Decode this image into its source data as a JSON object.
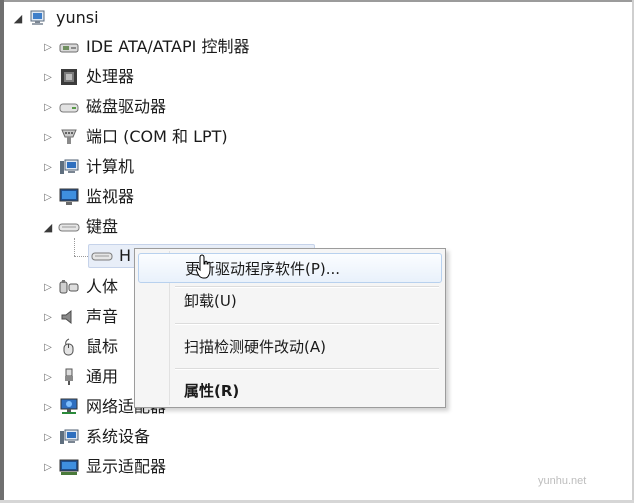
{
  "tree": {
    "root": {
      "label": "yunsi",
      "icon": "computer-icon"
    },
    "items": [
      {
        "label": "IDE ATA/ATAPI 控制器",
        "icon": "ide-controller-icon"
      },
      {
        "label": "处理器",
        "icon": "processor-icon"
      },
      {
        "label": "磁盘驱动器",
        "icon": "disk-drive-icon"
      },
      {
        "label": "端口 (COM 和 LPT)",
        "icon": "port-icon"
      },
      {
        "label": "计算机",
        "icon": "computer-icon"
      },
      {
        "label": "监视器",
        "icon": "monitor-icon"
      },
      {
        "label": "键盘",
        "icon": "keyboard-icon",
        "expanded": true
      },
      {
        "label": "人体",
        "icon": "hid-icon"
      },
      {
        "label": "声音",
        "icon": "sound-icon"
      },
      {
        "label": "鼠标",
        "icon": "mouse-icon"
      },
      {
        "label": "通用",
        "icon": "usb-icon"
      },
      {
        "label": "网络适配器",
        "icon": "network-adapter-icon"
      },
      {
        "label": "系统设备",
        "icon": "system-device-icon"
      },
      {
        "label": "显示适配器",
        "icon": "display-adapter-icon"
      }
    ],
    "child": {
      "label": "H",
      "icon": "keyboard-icon"
    }
  },
  "context_menu": {
    "items": [
      {
        "label": "更新驱动程序软件(P)..."
      },
      {
        "label": "卸载(U)"
      },
      {
        "label": "扫描检测硬件改动(A)"
      },
      {
        "label": "属性(R)"
      }
    ]
  },
  "watermark": "yunhu.net"
}
